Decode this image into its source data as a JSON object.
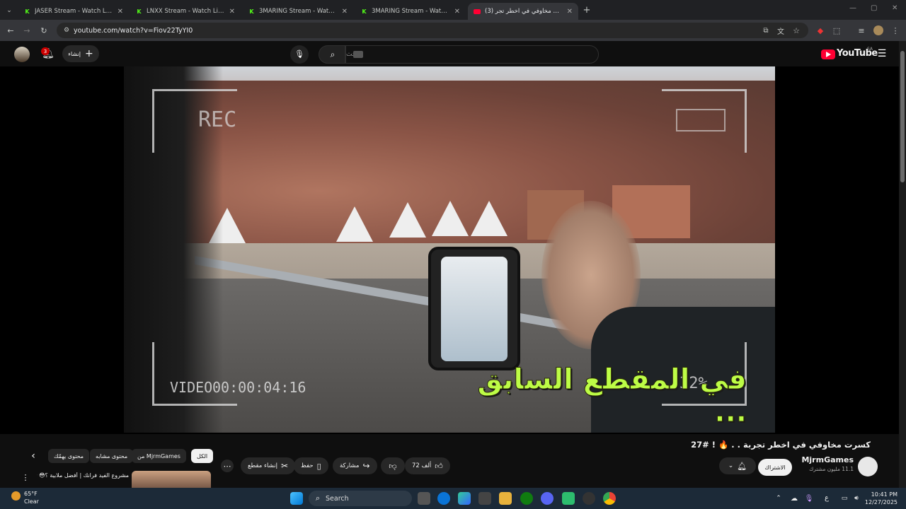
{
  "browser": {
    "tabs": [
      {
        "title": "JASER Stream - Watch Live on K",
        "favicon": "kick-icon"
      },
      {
        "title": "LNXX Stream - Watch Live on K",
        "favicon": "kick-icon"
      },
      {
        "title": "3MARING Stream - Watch Live",
        "favicon": "kick-icon"
      },
      {
        "title": "3MARING Stream - Watch Live",
        "favicon": "kick-icon"
      },
      {
        "title": "(3) كسرت مخاوفي في اخطر تجر",
        "favicon": "youtube-icon"
      }
    ],
    "url": "youtube.com/watch?v=Fiov22TyYI0"
  },
  "youtube": {
    "logo_text": "YouTube",
    "logo_region": "SA",
    "search_placeholder": "بحث",
    "create_label": "إنشاء",
    "notification_count": "3"
  },
  "video": {
    "overlay_rec": "REC",
    "overlay_video_label": "VIDEO",
    "overlay_timecode": "00:00:04:16",
    "overlay_percent": "32%",
    "subtitle": "في المقطع السابق ..."
  },
  "meta": {
    "title": "كسرت مخاوفي في اخطر تجربة . . 🔥 ! #27",
    "channel_name": "MjrmGames",
    "subscribers": "11.1 مليون مشترك",
    "subscribe_label": "الاشتراك",
    "likes": "72 ألف",
    "share_label": "مشاركة",
    "save_label": "حفظ",
    "clip_label": "إنشاء مقطع",
    "chips": [
      "الكل",
      "من MjrmGames",
      "محتوى مشابه",
      "محتوى يهمّك"
    ],
    "reco_title": "مشروع الفيد فرانك | أفضل ملابية ؟😳 #2"
  },
  "taskbar": {
    "weather_temp": "65°F",
    "weather_desc": "Clear",
    "search_label": "Search",
    "time": "10:41 PM",
    "date": "12/27/2025",
    "lang": "ع"
  },
  "colors": {
    "subtitle": "#bdfc46",
    "yt_red": "#ff0033",
    "kick_green": "#53fc18"
  }
}
